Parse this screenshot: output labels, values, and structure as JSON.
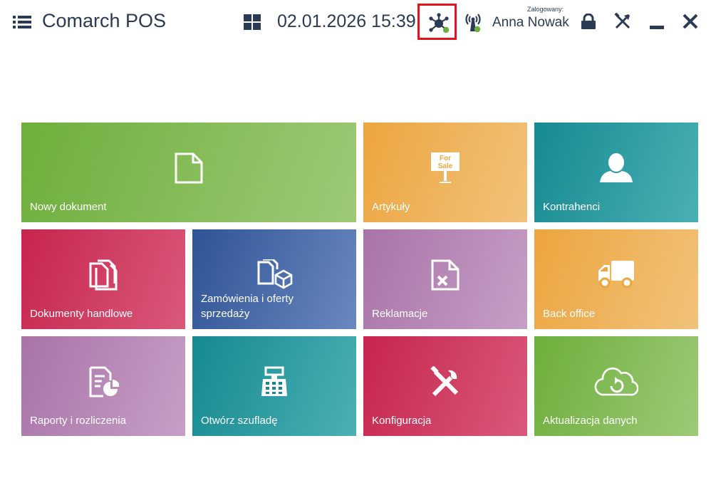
{
  "header": {
    "app_title": "Comarch POS",
    "datetime": "02.01.2026 15:39",
    "logged_label": "Zalogowany:",
    "user_name": "Anna Nowak"
  },
  "icons": {
    "menu": "hamburger-icon",
    "grid": "grid-icon",
    "network": "network-icon",
    "signal": "signal-icon",
    "lock": "lock-icon",
    "tools": "tools-icon",
    "minimize": "minimize-icon",
    "close": "close-icon"
  },
  "colors": {
    "header_text": "#2b3a55",
    "highlight_border": "#e0151b",
    "green": "#6caf3b",
    "orange": "#eda53e",
    "teal": "#158a91",
    "crimson": "#c7254d",
    "blue": "#2f5396",
    "purple": "#a973a8"
  },
  "tiles": {
    "nowy_dokument": "Nowy dokument",
    "artykuly": "Artykuły",
    "artykuly_sign_line1": "For",
    "artykuly_sign_line2": "Sale",
    "kontrahenci": "Kontrahenci",
    "dokumenty_handlowe": "Dokumenty handlowe",
    "zamowienia_line1": "Zamówienia i oferty",
    "zamowienia_line2": "sprzedaży",
    "reklamacje": "Reklamacje",
    "back_office": "Back office",
    "raporty": "Raporty i rozliczenia",
    "otworz_szuflade": "Otwórz szufladę",
    "konfiguracja": "Konfiguracja",
    "aktualizacja": "Aktualizacja danych"
  }
}
